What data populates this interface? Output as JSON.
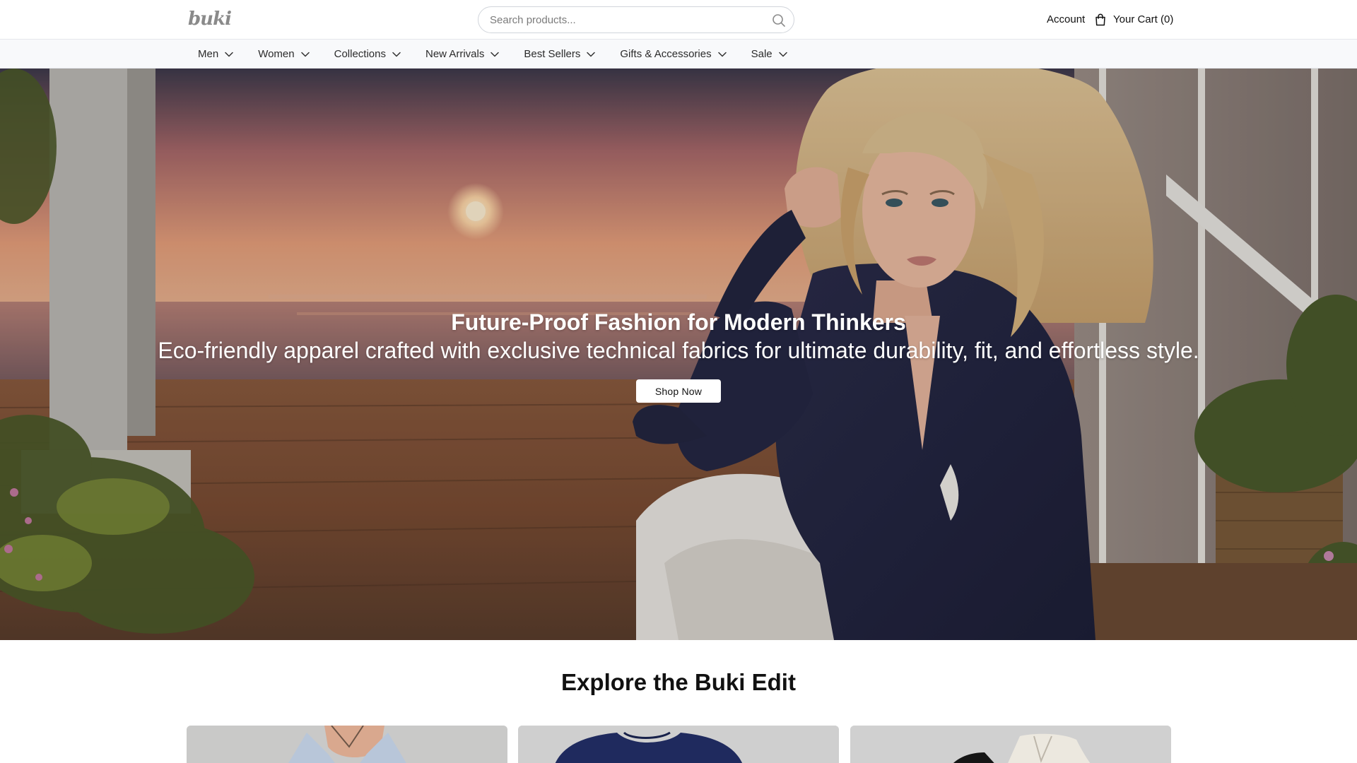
{
  "header": {
    "logo_text": "buki",
    "search": {
      "placeholder": "Search products..."
    },
    "account_label": "Account",
    "cart_label": "Your Cart (0)"
  },
  "nav": {
    "items": [
      {
        "label": "Men"
      },
      {
        "label": "Women"
      },
      {
        "label": "Collections"
      },
      {
        "label": "New Arrivals"
      },
      {
        "label": "Best Sellers"
      },
      {
        "label": "Gifts & Accessories"
      },
      {
        "label": "Sale"
      }
    ]
  },
  "hero": {
    "title": "Future-Proof Fashion for Modern Thinkers",
    "subtitle": "Eco-friendly apparel crafted with exclusive technical fabrics for ultimate durability, fit, and effortless style.",
    "cta_label": "Shop Now"
  },
  "explore": {
    "title": "Explore the Buki Edit"
  },
  "icons": {
    "search": "search-icon",
    "cart": "shopping-bag-icon",
    "dropdown": "chevron-down-icon"
  }
}
